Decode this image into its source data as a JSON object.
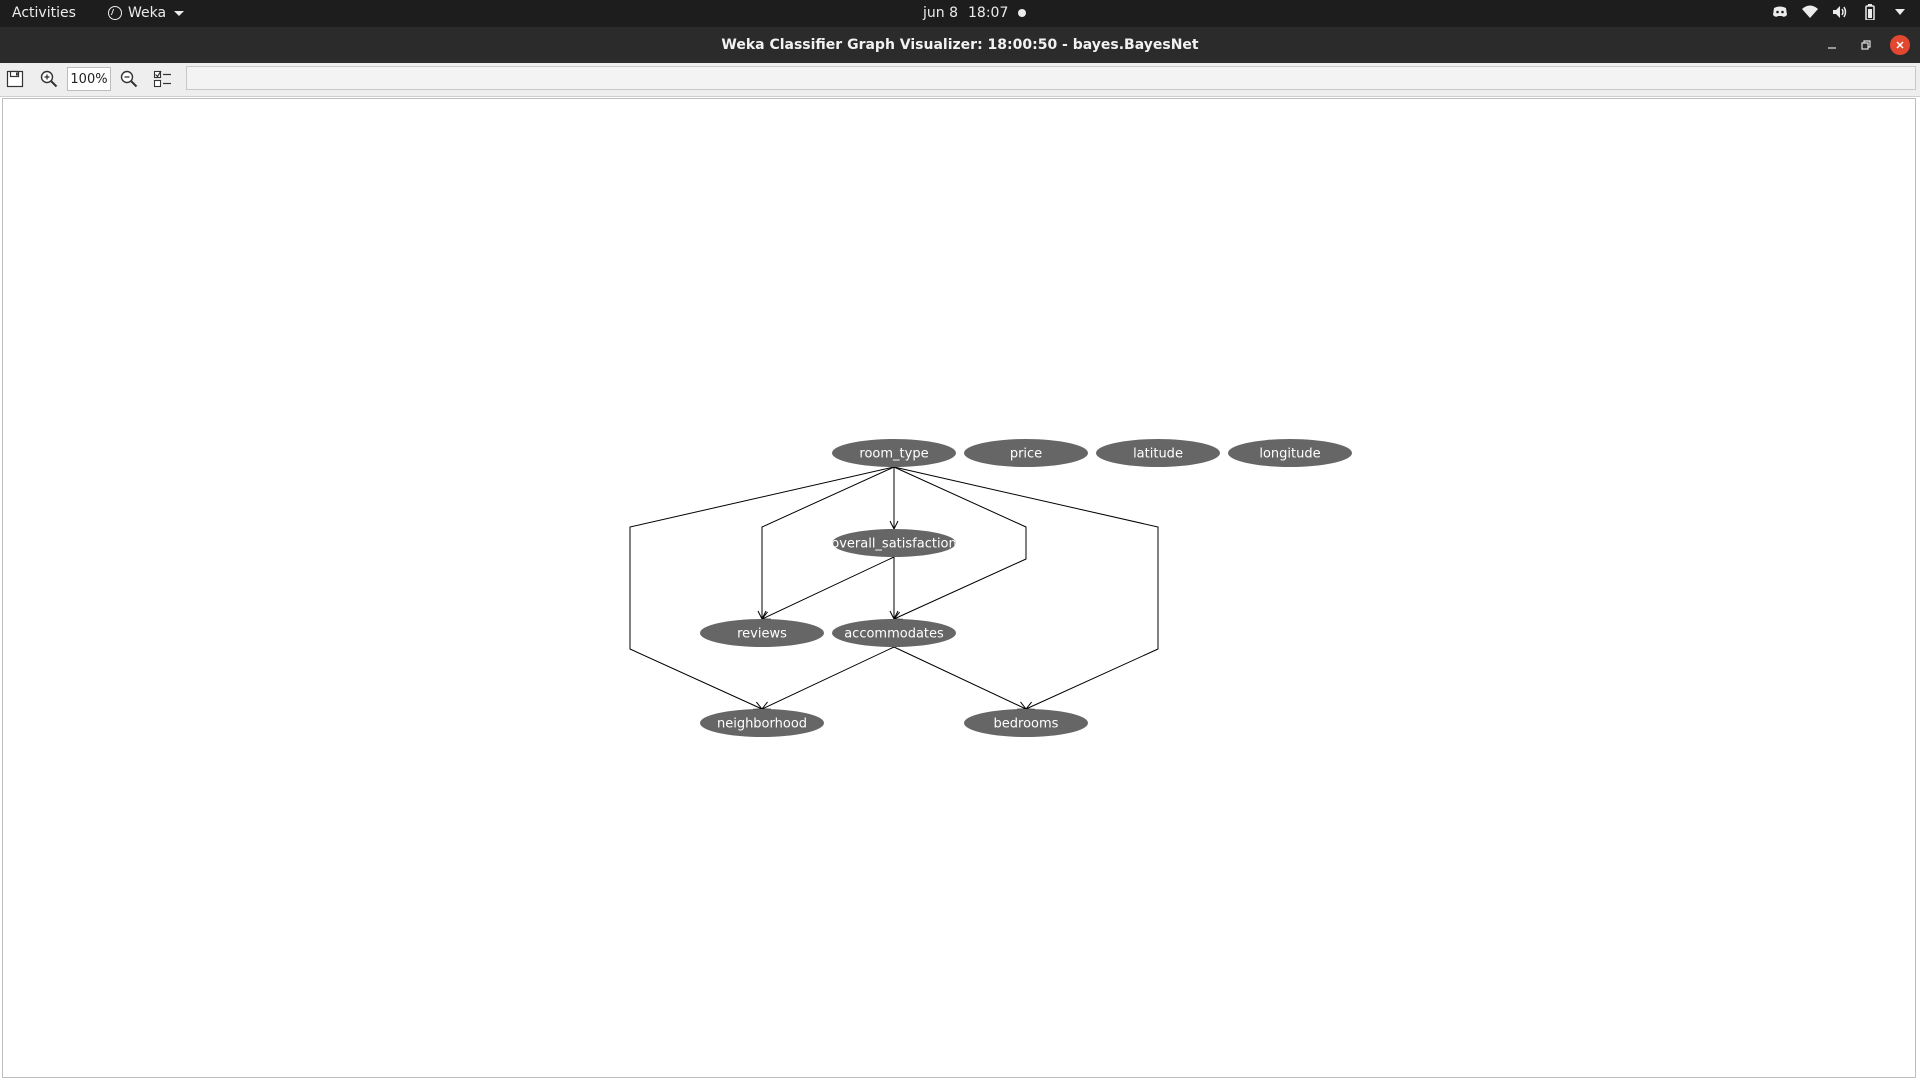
{
  "topbar": {
    "activities": "Activities",
    "app_name": "Weka",
    "date": "jun 8",
    "time": "18:07",
    "tray_icons": [
      "discord-icon",
      "wifi-icon",
      "volume-icon",
      "battery-icon",
      "system-menu-icon"
    ]
  },
  "window": {
    "title": "Weka Classifier Graph Visualizer: 18:00:50 - bayes.BayesNet",
    "buttons": [
      "minimize",
      "restore",
      "close"
    ]
  },
  "toolbar": {
    "save_icon": "save-icon",
    "zoom_in_icon": "zoom-in-icon",
    "zoom_value": "100%",
    "zoom_out_icon": "zoom-out-icon",
    "layout_icon": "extra-controls-icon"
  },
  "graph": {
    "node_color": "#666666",
    "edge_color": "#000000",
    "nodes": [
      {
        "id": "room_type",
        "label": "room_type"
      },
      {
        "id": "price",
        "label": "price"
      },
      {
        "id": "latitude",
        "label": "latitude"
      },
      {
        "id": "longitude",
        "label": "longitude"
      },
      {
        "id": "overall_satisfaction",
        "label": "overall_satisfaction"
      },
      {
        "id": "reviews",
        "label": "reviews"
      },
      {
        "id": "accommodates",
        "label": "accommodates"
      },
      {
        "id": "neighborhood",
        "label": "neighborhood"
      },
      {
        "id": "bedrooms",
        "label": "bedrooms"
      }
    ],
    "edges": [
      {
        "from": "room_type",
        "to": "overall_satisfaction"
      },
      {
        "from": "room_type",
        "to": "reviews"
      },
      {
        "from": "room_type",
        "to": "accommodates"
      },
      {
        "from": "room_type",
        "to": "neighborhood"
      },
      {
        "from": "room_type",
        "to": "bedrooms"
      },
      {
        "from": "overall_satisfaction",
        "to": "reviews"
      },
      {
        "from": "overall_satisfaction",
        "to": "accommodates"
      },
      {
        "from": "accommodates",
        "to": "neighborhood"
      },
      {
        "from": "accommodates",
        "to": "bedrooms"
      }
    ]
  }
}
